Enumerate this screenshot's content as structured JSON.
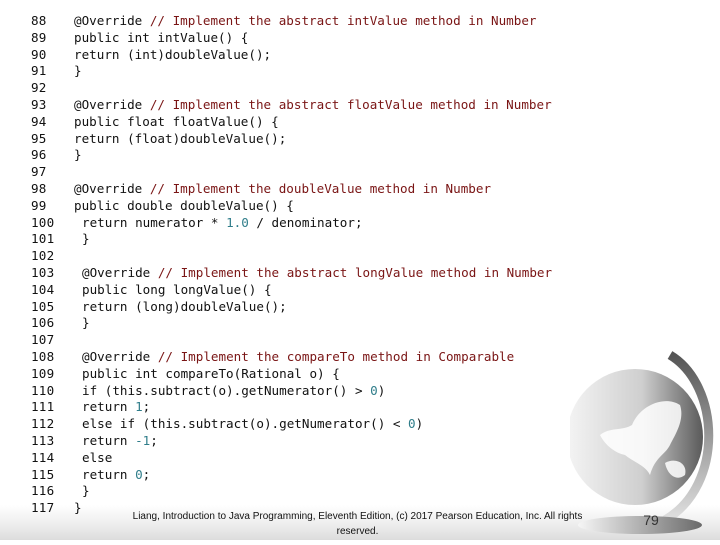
{
  "code": {
    "lines": [
      {
        "num": "88",
        "indent": false,
        "parts": [
          {
            "t": "@Override "
          },
          {
            "t": "// Implement the abstract intValue method in Number",
            "c": "cm"
          }
        ]
      },
      {
        "num": "89",
        "indent": false,
        "parts": [
          {
            "t": "public int intValue() {"
          }
        ]
      },
      {
        "num": "90",
        "indent": false,
        "parts": [
          {
            "t": "return (int)doubleValue();"
          }
        ]
      },
      {
        "num": "91",
        "indent": false,
        "parts": [
          {
            "t": "}"
          }
        ]
      },
      {
        "num": "92",
        "indent": false,
        "parts": []
      },
      {
        "num": "93",
        "indent": false,
        "parts": [
          {
            "t": "@Override "
          },
          {
            "t": "// Implement the abstract floatValue method in Number",
            "c": "cm"
          }
        ]
      },
      {
        "num": "94",
        "indent": false,
        "parts": [
          {
            "t": "public float floatValue() {"
          }
        ]
      },
      {
        "num": "95",
        "indent": false,
        "parts": [
          {
            "t": "return (float)doubleValue();"
          }
        ]
      },
      {
        "num": "96",
        "indent": false,
        "parts": [
          {
            "t": "}"
          }
        ]
      },
      {
        "num": "97",
        "indent": false,
        "parts": []
      },
      {
        "num": "98",
        "indent": false,
        "parts": [
          {
            "t": "@Override "
          },
          {
            "t": "// Implement the doubleValue method in Number",
            "c": "cm"
          }
        ]
      },
      {
        "num": "99",
        "indent": false,
        "parts": [
          {
            "t": "public double doubleValue() {"
          }
        ]
      },
      {
        "num": "100",
        "indent": true,
        "parts": [
          {
            "t": "return numerator * "
          },
          {
            "t": "1.0",
            "c": "nu"
          },
          {
            "t": " / denominator;"
          }
        ]
      },
      {
        "num": "101",
        "indent": true,
        "parts": [
          {
            "t": "}"
          }
        ]
      },
      {
        "num": "102",
        "indent": true,
        "parts": []
      },
      {
        "num": "103",
        "indent": true,
        "parts": [
          {
            "t": "@Override "
          },
          {
            "t": "// Implement the abstract longValue method in Number",
            "c": "cm"
          }
        ]
      },
      {
        "num": "104",
        "indent": true,
        "parts": [
          {
            "t": "public long longValue() {"
          }
        ]
      },
      {
        "num": "105",
        "indent": true,
        "parts": [
          {
            "t": "return (long)doubleValue();"
          }
        ]
      },
      {
        "num": "106",
        "indent": true,
        "parts": [
          {
            "t": "}"
          }
        ]
      },
      {
        "num": "107",
        "indent": true,
        "parts": []
      },
      {
        "num": "108",
        "indent": true,
        "parts": [
          {
            "t": "@Override "
          },
          {
            "t": "// Implement the compareTo method in Comparable",
            "c": "cm"
          }
        ]
      },
      {
        "num": "109",
        "indent": true,
        "parts": [
          {
            "t": "public int compareTo(Rational o) {"
          }
        ]
      },
      {
        "num": "110",
        "indent": true,
        "parts": [
          {
            "t": "if (this.subtract(o).getNumerator() > "
          },
          {
            "t": "0",
            "c": "nu"
          },
          {
            "t": ")"
          }
        ]
      },
      {
        "num": "111",
        "indent": true,
        "parts": [
          {
            "t": "return "
          },
          {
            "t": "1",
            "c": "nu"
          },
          {
            "t": ";"
          }
        ]
      },
      {
        "num": "112",
        "indent": true,
        "parts": [
          {
            "t": "else if (this.subtract(o).getNumerator() < "
          },
          {
            "t": "0",
            "c": "nu"
          },
          {
            "t": ")"
          }
        ]
      },
      {
        "num": "113",
        "indent": true,
        "parts": [
          {
            "t": "return "
          },
          {
            "t": "-1",
            "c": "nu"
          },
          {
            "t": ";"
          }
        ]
      },
      {
        "num": "114",
        "indent": true,
        "parts": [
          {
            "t": "else"
          }
        ]
      },
      {
        "num": "115",
        "indent": true,
        "parts": [
          {
            "t": "return "
          },
          {
            "t": "0",
            "c": "nu"
          },
          {
            "t": ";"
          }
        ]
      },
      {
        "num": "116",
        "indent": true,
        "parts": [
          {
            "t": "}"
          }
        ]
      },
      {
        "num": "117",
        "indent": false,
        "parts": [
          {
            "t": "}"
          }
        ]
      }
    ]
  },
  "colors": {
    "comment": "#7a1515",
    "number_literal": "#2f7d8a",
    "text": "#111111"
  },
  "footer": {
    "copyright": "Liang, Introduction to Java Programming, Eleventh Edition, (c) 2017 Pearson Education, Inc. All rights reserved.",
    "page_number": "79"
  },
  "decoration": {
    "logo_icon": "globe-icon"
  }
}
